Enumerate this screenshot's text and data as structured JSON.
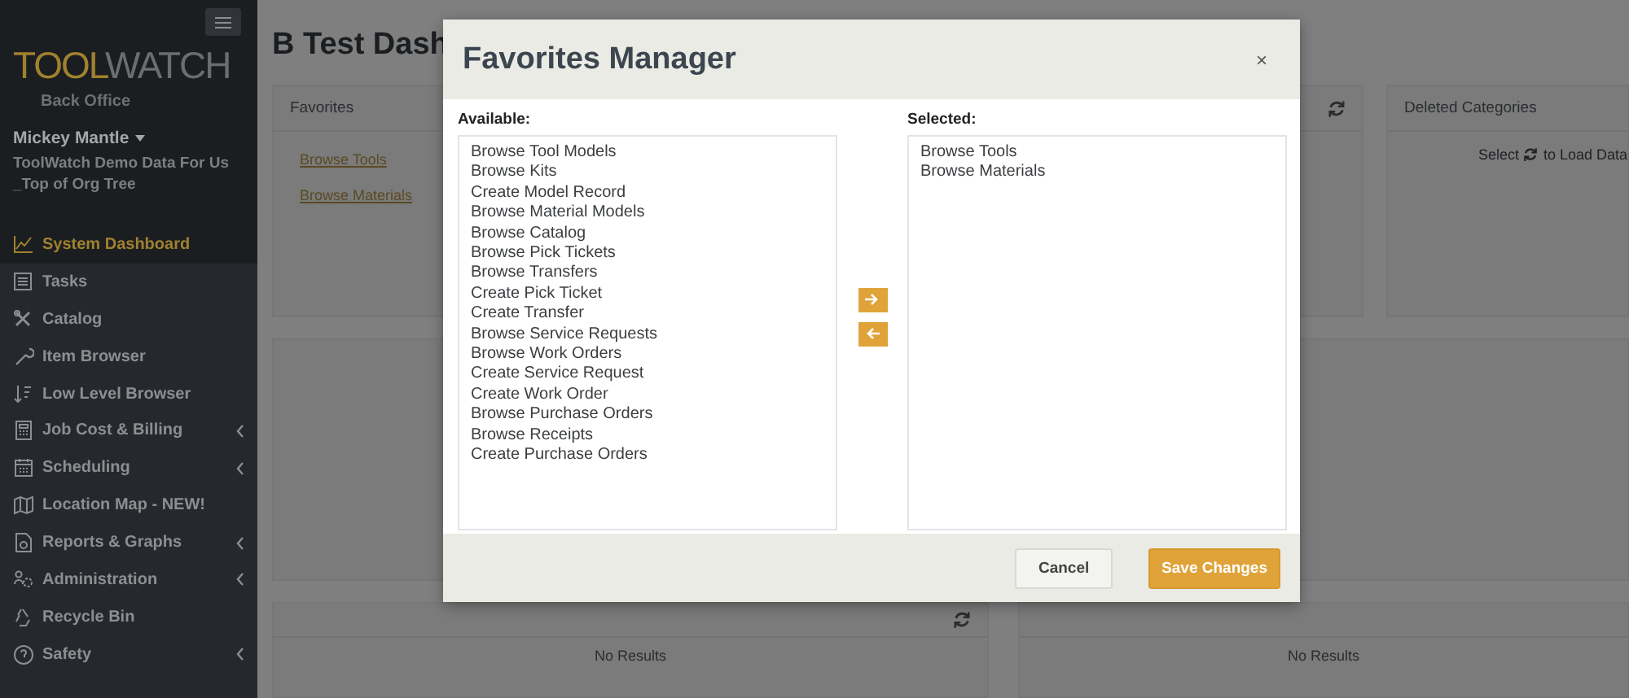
{
  "sidebar": {
    "logo": {
      "part_1": "TOOL",
      "part_2": "WATCH"
    },
    "subtitle": "Back Office",
    "user": "Mickey Mantle",
    "org_lines": [
      "ToolWatch Demo Data For Us",
      "_Top of Org Tree"
    ],
    "items": [
      {
        "label": "System Dashboard",
        "selected": true,
        "submenu": false
      },
      {
        "label": "Tasks",
        "selected": false,
        "submenu": false
      },
      {
        "label": "Catalog",
        "selected": false,
        "submenu": false
      },
      {
        "label": "Item Browser",
        "selected": false,
        "submenu": false
      },
      {
        "label": "Low Level Browser",
        "selected": false,
        "submenu": false
      },
      {
        "label": "Job Cost & Billing",
        "selected": false,
        "submenu": true
      },
      {
        "label": "Scheduling",
        "selected": false,
        "submenu": true
      },
      {
        "label": "Location Map - NEW!",
        "selected": false,
        "submenu": false
      },
      {
        "label": "Reports & Graphs",
        "selected": false,
        "submenu": true
      },
      {
        "label": "Administration",
        "selected": false,
        "submenu": true
      },
      {
        "label": "Recycle Bin",
        "selected": false,
        "submenu": false
      },
      {
        "label": "Safety",
        "selected": false,
        "submenu": true
      }
    ]
  },
  "main": {
    "page_title": "B Test Dash",
    "favorites_card": {
      "title": "Favorites",
      "links": [
        "Browse Tools",
        "Browse Materials"
      ]
    },
    "deleted_card": {
      "title": "Deleted Categories",
      "hint_before": "Select",
      "hint_after": "to Load Data"
    },
    "bottom_cards": [
      {
        "refresh": true,
        "message": "No Results"
      },
      {
        "refresh": false,
        "message": "No Results"
      }
    ]
  },
  "modal": {
    "title": "Favorites Manager",
    "close": "×",
    "available_label": "Available:",
    "available": [
      "Browse Tool Models",
      "Browse Kits",
      "Create Model Record",
      "Browse Material Models",
      "Browse Catalog",
      "Browse Pick Tickets",
      "Browse Transfers",
      "Create Pick Ticket",
      "Create Transfer",
      "Browse Service Requests",
      "Browse Work Orders",
      "Create Service Request",
      "Create Work Order",
      "Browse Purchase Orders",
      "Browse Receipts",
      "Create Purchase Orders"
    ],
    "selected_label": "Selected:",
    "selected": [
      "Browse Tools",
      "Browse Materials"
    ],
    "buttons": [
      {
        "label": "Cancel",
        "kind": "secondary"
      },
      {
        "label": "Save Changes",
        "kind": "primary"
      }
    ]
  }
}
